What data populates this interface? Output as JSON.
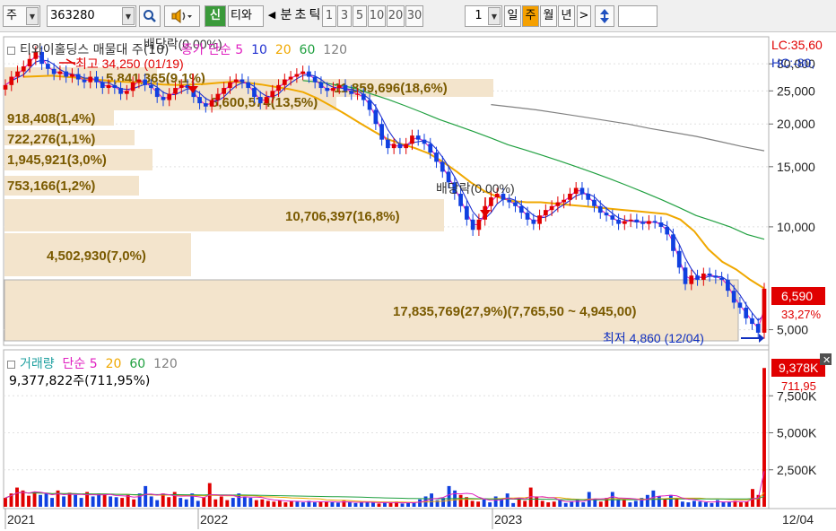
{
  "toolbar": {
    "market": "주",
    "code": "363280",
    "search_icon": "magnifier-icon",
    "sound_icon": "speaker-icon",
    "badge": "신",
    "stock_name": "티와",
    "prev_arrow": "◀",
    "tabs": [
      "분",
      "초",
      "틱",
      "1",
      "3",
      "5",
      "10",
      "20",
      "30"
    ],
    "count_value": "1",
    "periods": [
      "일",
      "주",
      "월",
      "년"
    ],
    "active_period": "주",
    "next_arrow": ">",
    "sort_icon": "updown-arrow-icon"
  },
  "price_panel": {
    "legend_name": "티와이홀딩스 매물대 주(10)",
    "legend_overlap": "배당락(0.00%)",
    "legend_close": "종가",
    "legend_simple": "단순",
    "ma_periods": [
      "5",
      "10",
      "20",
      "60",
      "120"
    ],
    "ma_colors": [
      "#e020c0",
      "#2030d0",
      "#f0a800",
      "#20a040",
      "#808080"
    ],
    "lc_label": "LC:35,60",
    "hc_label": "HC:-80,",
    "y_ticks": [
      "30,000",
      "25,000",
      "20,000",
      "15,000",
      "10,000",
      "5,000"
    ],
    "current_price": "6,590",
    "current_change": "33,27%",
    "high_label": "최고 34,250 (01/19)",
    "low_label": "최저 4,860 (12/04)",
    "dividend_labels": [
      "배당락(0.00%)",
      "배당락(0.00%)"
    ],
    "volume_profile": [
      {
        "label": "5,841,365(9,1%)"
      },
      {
        "label": "11,859,696(18,6%)"
      },
      {
        "label": "8,600,574(13,5%)"
      },
      {
        "label": "918,408(1,4%)"
      },
      {
        "label": "722,276(1,1%)"
      },
      {
        "label": "1,945,921(3,0%)"
      },
      {
        "label": "753,166(1,2%)"
      },
      {
        "label": "10,706,397(16,8%)"
      },
      {
        "label": "4,502,930(7,0%)"
      },
      {
        "label": "17,835,769(27,9%)(7,765,50 ~ 4,945,00)"
      }
    ]
  },
  "volume_panel": {
    "legend_name": "거래량",
    "legend_simple": "단순",
    "ma_periods": [
      "5",
      "20",
      "60",
      "120"
    ],
    "last_volume": "9,377,822주(711,95%)",
    "y_ticks": [
      "7,500K",
      "5,000K",
      "2,500K"
    ],
    "current_volume": "9,378K",
    "current_pct": "711,95",
    "close_icon": "close-icon"
  },
  "x_axis": {
    "labels": [
      "2021",
      "2022",
      "2023"
    ],
    "end_date": "12/04"
  },
  "chart_data": {
    "type": "candlestick",
    "interval": "weekly",
    "x_labels": [
      "2021",
      "2022",
      "2023"
    ],
    "ylim": [
      4500,
      36000
    ],
    "y_scale": "log",
    "close_series": [
      26000,
      27500,
      28500,
      29500,
      31000,
      32500,
      30000,
      29000,
      28000,
      28500,
      27500,
      28000,
      27000,
      26500,
      27500,
      26500,
      25500,
      26000,
      25500,
      24500,
      25000,
      26500,
      27000,
      26000,
      25500,
      24000,
      23500,
      24500,
      25500,
      26000,
      25500,
      24000,
      23000,
      22500,
      23500,
      24500,
      25500,
      26500,
      27000,
      26500,
      25500,
      24000,
      23000,
      24000,
      25000,
      26000,
      27000,
      27500,
      28000,
      28500,
      27500,
      26500,
      25500,
      25000,
      25500,
      26000,
      25000,
      24500,
      24500,
      23500,
      22000,
      20000,
      18000,
      17000,
      17500,
      17000,
      17500,
      18500,
      18000,
      17500,
      16500,
      15500,
      14500,
      13500,
      12500,
      11500,
      10500,
      9800,
      10500,
      11500,
      12200,
      12500,
      12000,
      11800,
      11500,
      11000,
      10500,
      10200,
      10800,
      11200,
      11500,
      11800,
      12000,
      12500,
      13000,
      12500,
      12000,
      11500,
      11000,
      10800,
      10500,
      10200,
      10400,
      10500,
      10300,
      10200,
      10400,
      10300,
      10000,
      9500,
      8500,
      7600,
      6800,
      7200,
      7000,
      7300,
      7200,
      7100,
      7000,
      6500,
      6000,
      5800,
      5400,
      5200,
      4900,
      6590
    ],
    "ma20_series": [
      27500,
      27600,
      27700,
      27500,
      27300,
      27000,
      26800,
      26600,
      26500,
      26300,
      26100,
      26000,
      26100,
      26200,
      26400,
      26600,
      26400,
      26100,
      25700,
      25300,
      24800,
      23800,
      22600,
      21400,
      20200,
      19100,
      18100,
      17500,
      17000,
      16400,
      15500,
      14500,
      13500,
      12700,
      12200,
      11900,
      11800,
      11800,
      11700,
      11600,
      11500,
      11400,
      11300,
      11200,
      11100,
      11000,
      10900,
      10500,
      9700,
      8600,
      7900,
      7500,
      7000,
      6600
    ],
    "ma60_series": [
      26800,
      26500,
      26000,
      25500,
      24500,
      23600,
      22600,
      21600,
      20600,
      19800,
      19000,
      18200,
      17400,
      16800,
      16200,
      15600,
      15000,
      14400,
      13800,
      13200,
      12600,
      12000,
      11400,
      10800,
      10400,
      10000,
      9500,
      9200
    ],
    "ma120_series": [
      22800,
      22400,
      22000,
      21500,
      21000,
      20500,
      20000,
      19400,
      18900,
      18400,
      17800,
      17200,
      16700
    ],
    "volume_unit": "K",
    "volume_ylim": [
      0,
      10000
    ],
    "volume_series": [
      600,
      900,
      1300,
      1100,
      750,
      1000,
      800,
      900,
      600,
      1100,
      700,
      950,
      800,
      600,
      1000,
      700,
      900,
      850,
      700,
      650,
      600,
      800,
      500,
      900,
      1400,
      700,
      450,
      900,
      650,
      1000,
      600,
      500,
      900,
      400,
      650,
      1600,
      500,
      700,
      450,
      600,
      900,
      700,
      600,
      450,
      500,
      400,
      350,
      450,
      300,
      400,
      350,
      300,
      400,
      300,
      350,
      350,
      300,
      280,
      400,
      300,
      250,
      300,
      350,
      280,
      220,
      300,
      250,
      350,
      220,
      250,
      300,
      500,
      700,
      900,
      450,
      600,
      1400,
      1100,
      800,
      650,
      400,
      350,
      500,
      300,
      700,
      500,
      900,
      250,
      600,
      400,
      1300,
      700,
      400,
      300,
      350,
      500,
      250,
      350,
      450,
      300,
      1000,
      550,
      350,
      600,
      1000,
      500,
      450,
      300,
      400,
      600,
      800,
      1100,
      700,
      500,
      800,
      600,
      350,
      300,
      400,
      350,
      300,
      250,
      450,
      300,
      350,
      400,
      300,
      350,
      1200,
      800,
      9378
    ]
  }
}
